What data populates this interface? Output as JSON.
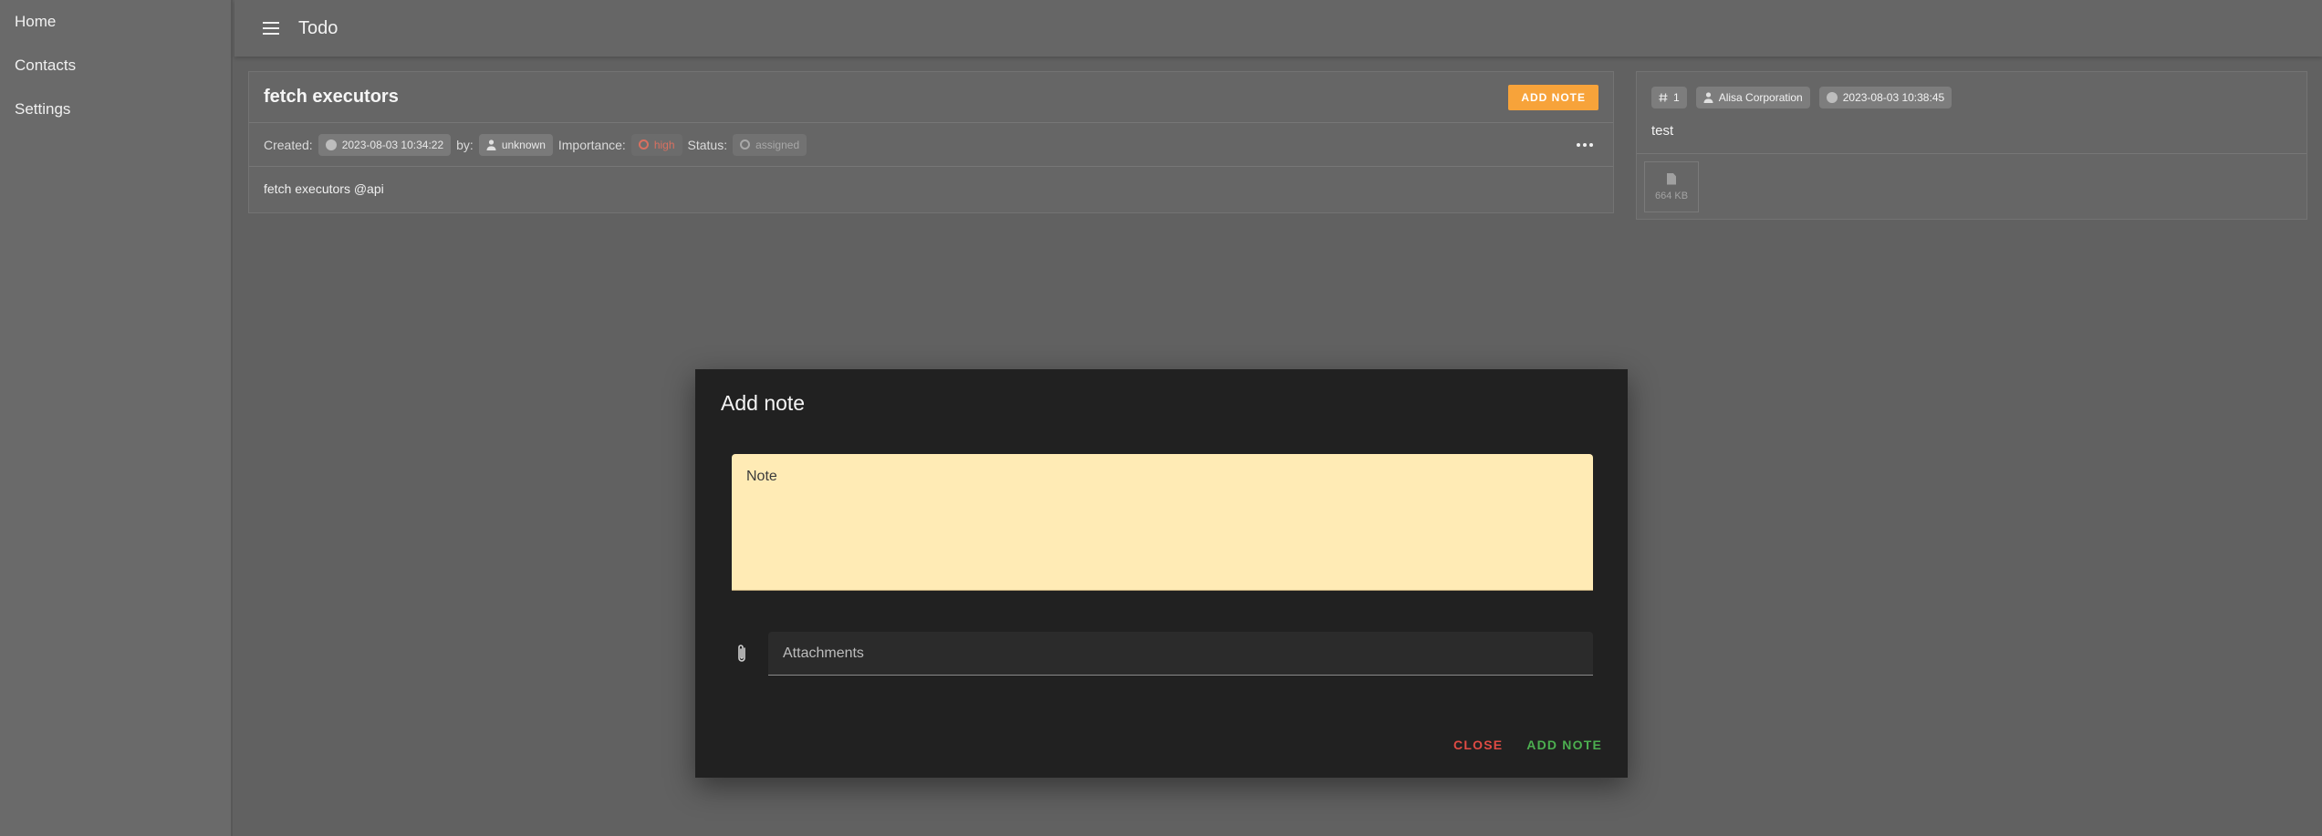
{
  "sidebar": {
    "items": [
      {
        "label": "Home"
      },
      {
        "label": "Contacts"
      },
      {
        "label": "Settings"
      }
    ]
  },
  "appbar": {
    "title": "Todo",
    "menu_icon": "menu-icon"
  },
  "todo": {
    "title": "fetch executors",
    "add_note_label": "ADD NOTE",
    "created_label": "Created:",
    "created_value": "2023-08-03 10:34:22",
    "by_label": "by:",
    "by_value": "unknown",
    "importance_label": "Importance:",
    "importance_value": "high",
    "status_label": "Status:",
    "status_value": "assigned",
    "body": "fetch executors @api"
  },
  "note": {
    "id": "1",
    "author": "Alisa Corporation",
    "timestamp": "2023-08-03 10:38:45",
    "text": "test",
    "attachment_size": "664 KB"
  },
  "dialog": {
    "title": "Add note",
    "note_label": "Note",
    "attachments_placeholder": "Attachments",
    "close_label": "CLOSE",
    "add_label": "ADD NOTE"
  },
  "colors": {
    "accent": "#f7a33a",
    "note_bg": "#ffebb5",
    "danger": "#e04b44",
    "success": "#4caf50",
    "importance_high": "#d97060"
  }
}
